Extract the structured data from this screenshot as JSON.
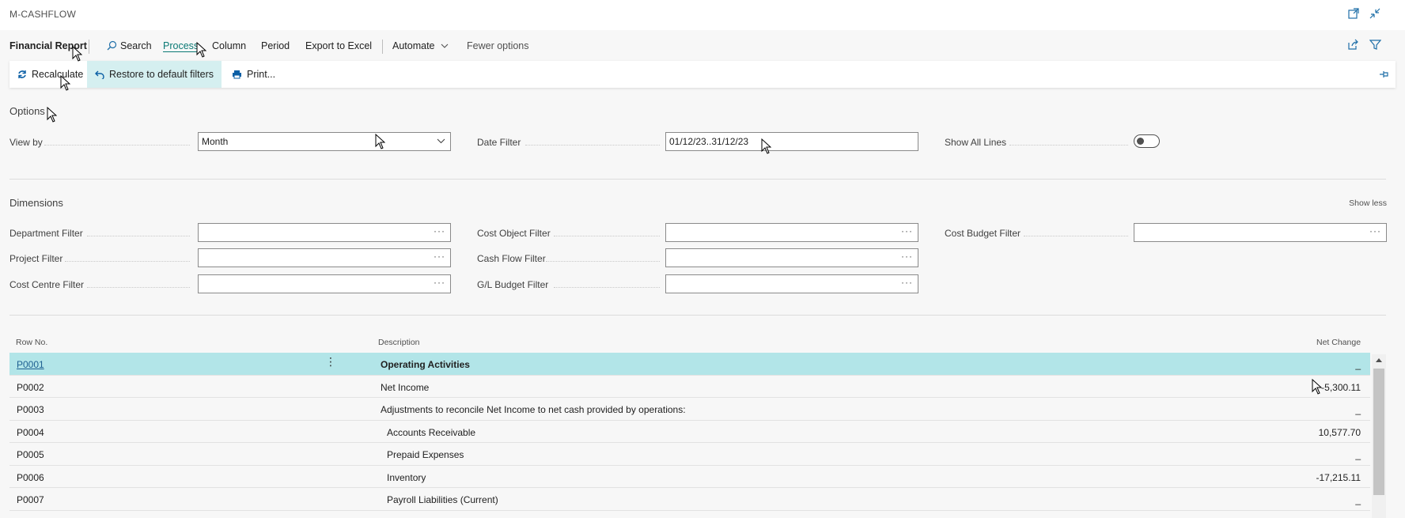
{
  "window": {
    "title": "M-CASHFLOW"
  },
  "actionbar": {
    "page_name": "Financial Report",
    "search": "Search",
    "process": "Process",
    "column": "Column",
    "period": "Period",
    "export": "Export to Excel",
    "automate": "Automate",
    "fewer_options": "Fewer options"
  },
  "subbar": {
    "recalculate": "Recalculate",
    "restore": "Restore to default filters",
    "print": "Print..."
  },
  "options": {
    "title": "Options",
    "view_by_label": "View by",
    "view_by_value": "Month",
    "date_filter_label": "Date Filter",
    "date_filter_value": "01/12/23..31/12/23",
    "show_all_lines_label": "Show All Lines",
    "show_all_lines_on": false
  },
  "dimensions": {
    "title": "Dimensions",
    "show_less": "Show less",
    "department_filter": "Department Filter",
    "project_filter": "Project Filter",
    "cost_centre_filter": "Cost Centre Filter",
    "cost_object_filter": "Cost Object Filter",
    "cash_flow_filter": "Cash Flow Filter",
    "gl_budget_filter": "G/L Budget Filter",
    "cost_budget_filter": "Cost Budget Filter",
    "ellipsis": "···"
  },
  "grid": {
    "headers": {
      "row_no": "Row No.",
      "description": "Description",
      "net_change": "Net Change"
    },
    "rows": [
      {
        "no": "P0001",
        "desc": "Operating Activities",
        "val": "_"
      },
      {
        "no": "P0002",
        "desc": "Net Income",
        "val": "-5,300.11"
      },
      {
        "no": "P0003",
        "desc": "Adjustments to reconcile Net Income to net cash provided by operations:",
        "val": "_"
      },
      {
        "no": "P0004",
        "desc": "Accounts Receivable",
        "val": "10,577.70"
      },
      {
        "no": "P0005",
        "desc": "Prepaid Expenses",
        "val": "_"
      },
      {
        "no": "P0006",
        "desc": "Inventory",
        "val": "-17,215.11"
      },
      {
        "no": "P0007",
        "desc": "Payroll Liabilities (Current)",
        "val": "_"
      }
    ]
  },
  "colors": {
    "accent": "#0b7a75",
    "selected_row": "#b2e5e8",
    "link": "#1e5f91"
  }
}
